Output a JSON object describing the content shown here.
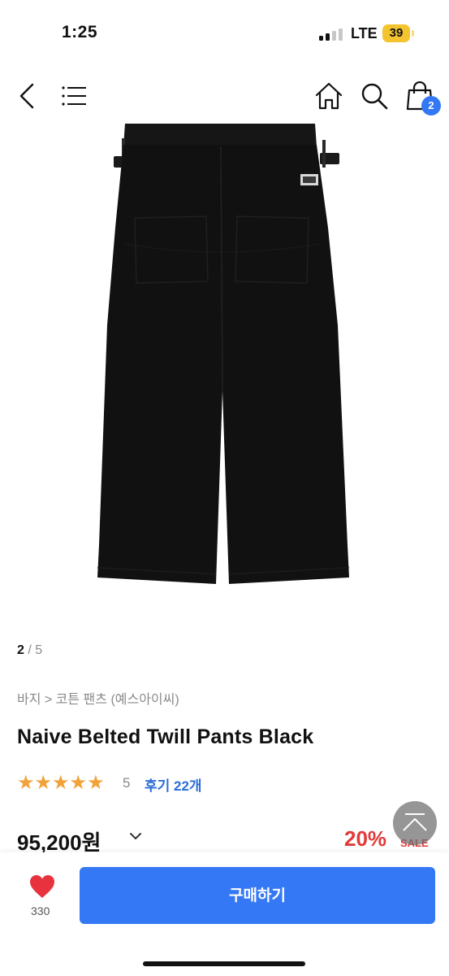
{
  "status_bar": {
    "time": "1:25",
    "network": "LTE",
    "battery": "39"
  },
  "nav": {
    "back_icon": "chevron-left-icon",
    "menu_icon": "hamburger-menu-icon",
    "home_icon": "home-icon",
    "search_icon": "search-icon",
    "cart_icon": "shopping-bag-icon",
    "cart_count": "2"
  },
  "gallery": {
    "current": "2",
    "separator": " / ",
    "total": "5"
  },
  "product": {
    "breadcrumb": "바지 > 코튼 팬츠 (예스아이씨)",
    "title": "Naive Belted Twill Pants Black",
    "rating_stars": "★★★★★",
    "rating_value": "5",
    "reviews": "후기 22개",
    "price": "95,200원",
    "discount": "20%",
    "sale_label": "SALE"
  },
  "bottom_bar": {
    "like_icon": "heart-icon",
    "like_count": "330",
    "buy_label": "구매하기"
  },
  "colors": {
    "accent": "#3478f6",
    "star": "#f2a23a",
    "discount": "#e03a3a",
    "heart": "#e8333f",
    "battery": "#f4c430"
  }
}
